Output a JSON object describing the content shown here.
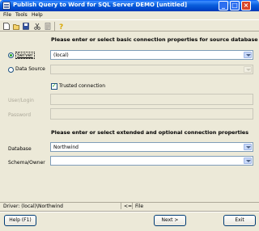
{
  "window": {
    "title": "Publish Query to Word for SQL Server DEMO [untitled]"
  },
  "menu": {
    "items": [
      "File",
      "Tools",
      "Help"
    ]
  },
  "toolbar": {
    "icons": [
      "new-icon",
      "open-icon",
      "save-icon",
      "cut-icon",
      "properties-icon",
      "help-icon"
    ]
  },
  "source_section": {
    "title": "Please enter or select basic connection properties for source database"
  },
  "server": {
    "label": "Server",
    "value": "(local)",
    "selected": true
  },
  "data_source": {
    "label": "Data Source",
    "value": ""
  },
  "trusted": {
    "label": "Trusted connection",
    "checked": true
  },
  "user_login": {
    "label": "User/Login",
    "value": ""
  },
  "password": {
    "label": "Password",
    "value": ""
  },
  "extended_section": {
    "title": "Please enter or select extended and optional connection properties"
  },
  "database": {
    "label": "Database",
    "value": "Northwind"
  },
  "schema": {
    "label": "Schema/Owner",
    "value": ""
  },
  "status": {
    "driver": "Driver: (local)\\Northwind",
    "arrows": "<=",
    "file": "File"
  },
  "buttons": {
    "help": "Help (F1)",
    "next": "Next >",
    "exit": "Exit"
  },
  "colors": {
    "title_bar": "#0a5fdc",
    "window_bg": "#ece9d8",
    "radio_dot": "#21a121"
  }
}
